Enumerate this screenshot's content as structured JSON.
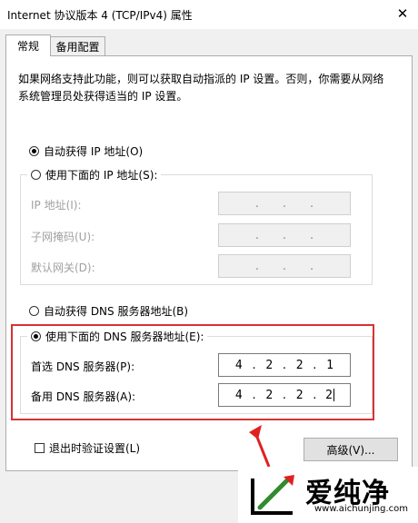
{
  "window": {
    "title": "Internet 协议版本 4 (TCP/IPv4) 属性",
    "close_glyph": "✕"
  },
  "tabs": [
    {
      "label": "常规"
    },
    {
      "label": "备用配置"
    }
  ],
  "description": "如果网络支持此功能，则可以获取自动指派的 IP 设置。否则，你需要从网络系统管理员处获得适当的 IP 设置。",
  "ip_section": {
    "auto_label": "自动获得 IP 地址(O)",
    "manual_label": "使用下面的 IP 地址(S):",
    "selected": "auto",
    "fields": [
      {
        "label": "IP 地址(I):",
        "octets": [
          "",
          "",
          "",
          ""
        ]
      },
      {
        "label": "子网掩码(U):",
        "octets": [
          "",
          "",
          "",
          ""
        ]
      },
      {
        "label": "默认网关(D):",
        "octets": [
          "",
          "",
          "",
          ""
        ]
      }
    ]
  },
  "dns_section": {
    "auto_label": "自动获得 DNS 服务器地址(B)",
    "manual_label": "使用下面的 DNS 服务器地址(E):",
    "selected": "manual",
    "preferred": {
      "label": "首选 DNS 服务器(P):",
      "octets": [
        "4",
        "2",
        "2",
        "1"
      ]
    },
    "alternate": {
      "label": "备用 DNS 服务器(A):",
      "octets": [
        "4",
        "2",
        "2",
        "2"
      ]
    }
  },
  "validate_checkbox": {
    "label": "退出时验证设置(L)",
    "checked": false
  },
  "advanced_button": {
    "label": "高级(V)..."
  },
  "watermark": {
    "text": "爱纯净",
    "url": "www.aichunjing.com"
  },
  "colors": {
    "highlight_box": "#d63232",
    "watermark_green": "#2e8b2e",
    "watermark_arrow": "#e02020"
  }
}
